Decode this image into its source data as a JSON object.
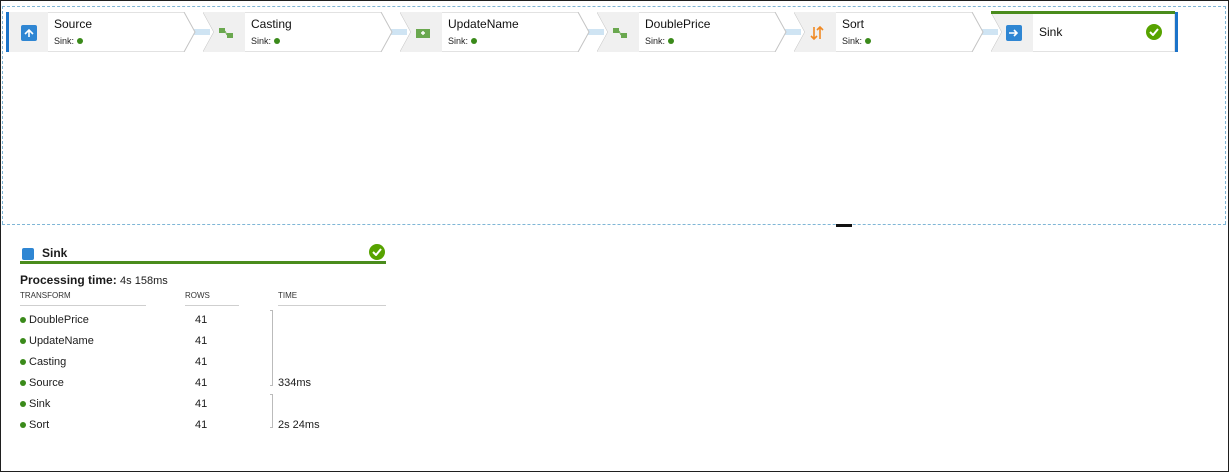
{
  "pipeline": {
    "nodes": [
      {
        "name": "Source",
        "sub": "Sink:",
        "icon": "source-icon",
        "color": "#2f86d3"
      },
      {
        "name": "Casting",
        "sub": "Sink:",
        "icon": "casting-icon",
        "color": "#6aa84f"
      },
      {
        "name": "UpdateName",
        "sub": "Sink:",
        "icon": "update-name-icon",
        "color": "#6aa84f"
      },
      {
        "name": "DoublePrice",
        "sub": "Sink:",
        "icon": "double-price-icon",
        "color": "#6aa84f"
      },
      {
        "name": "Sort",
        "sub": "Sink:",
        "icon": "sort-icon",
        "color": "#f08a24"
      },
      {
        "name": "Sink",
        "icon": "sink-icon",
        "color": "#2f86d3"
      }
    ],
    "status_color": "#3a8a1a",
    "success_color": "#57a300"
  },
  "panel": {
    "title": "Sink",
    "processing_label": "Processing time:",
    "processing_value": "4s 158ms",
    "headers": {
      "transform": "TRANSFORM",
      "rows": "ROWS",
      "time": "TIME"
    },
    "rows": [
      {
        "name": "DoublePrice",
        "rows": "41",
        "time": ""
      },
      {
        "name": "UpdateName",
        "rows": "41",
        "time": ""
      },
      {
        "name": "Casting",
        "rows": "41",
        "time": ""
      },
      {
        "name": "Source",
        "rows": "41",
        "time": "334ms"
      },
      {
        "name": "Sink",
        "rows": "41",
        "time": ""
      },
      {
        "name": "Sort",
        "rows": "41",
        "time": "2s 24ms"
      }
    ]
  }
}
